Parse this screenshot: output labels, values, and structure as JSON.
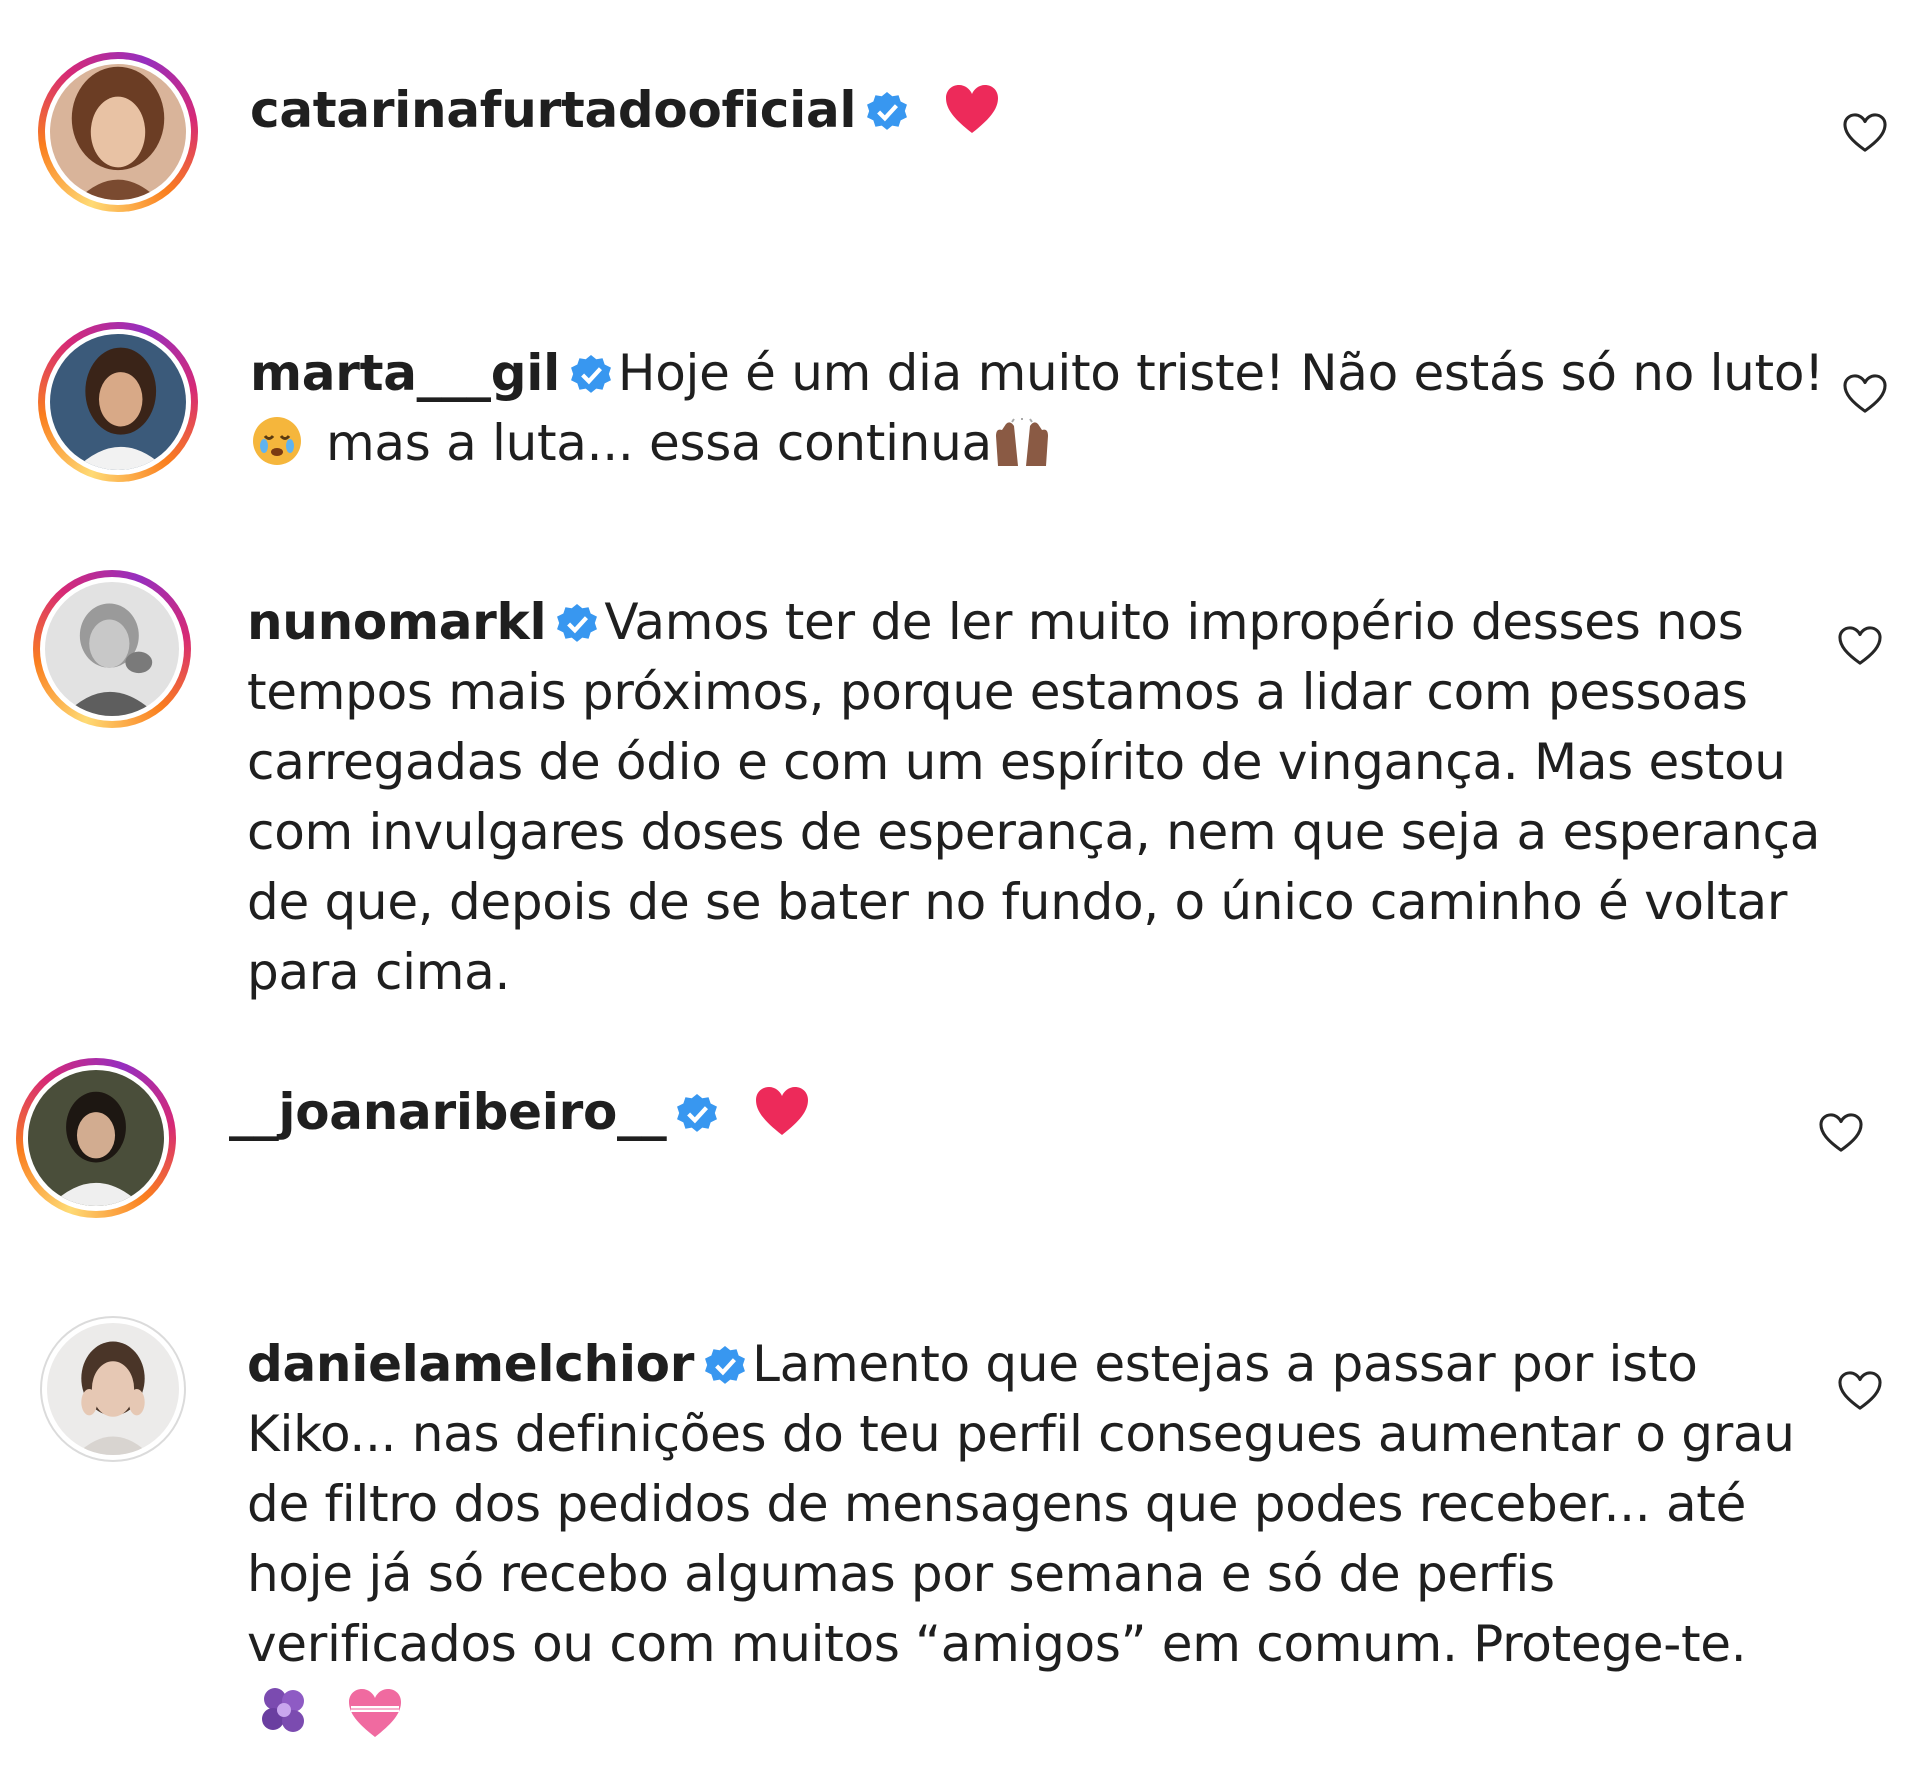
{
  "colors": {
    "verified": "#3897f0",
    "heart": "#ed4956",
    "text": "#1f1f1f"
  },
  "comments": [
    {
      "username": "catarinafurtadooficial",
      "verified": true,
      "text": "",
      "emoji": [
        "red-heart"
      ]
    },
    {
      "username": "marta___gil",
      "verified": true,
      "text": "Hoje é um dia muito triste! Não estás só no luto!",
      "text2": "mas a luta... essa continua",
      "emoji": [
        "crying-face",
        "raised-hands"
      ]
    },
    {
      "username": "nunomarkl",
      "verified": true,
      "lines": [
        "Vamos ter de ler muito impropério desses nos",
        "tempos mais próximos, porque estamos a lidar com pessoas",
        "carregadas de ódio e com um espírito de vingança. Mas estou",
        "com invulgares doses de esperança, nem que seja a esperança",
        "de que, depois de se bater no fundo, o único caminho é voltar",
        "para cima."
      ]
    },
    {
      "username": "__joanaribeiro__",
      "verified": true,
      "text": "",
      "emoji": [
        "red-heart"
      ]
    },
    {
      "username": "danielamelchior",
      "verified": true,
      "lines": [
        "Lamento que estejas a passar por isto",
        "Kiko... nas definições do teu perfil consegues aumentar o grau",
        "de filtro dos pedidos de mensagens que podes receber... até",
        "hoje já só recebo algumas por semana e só de perfis",
        "verificados ou com muitos “amigos” em comum. Protege-te."
      ],
      "emoji": [
        "purple-flower",
        "heart-gift"
      ]
    }
  ]
}
